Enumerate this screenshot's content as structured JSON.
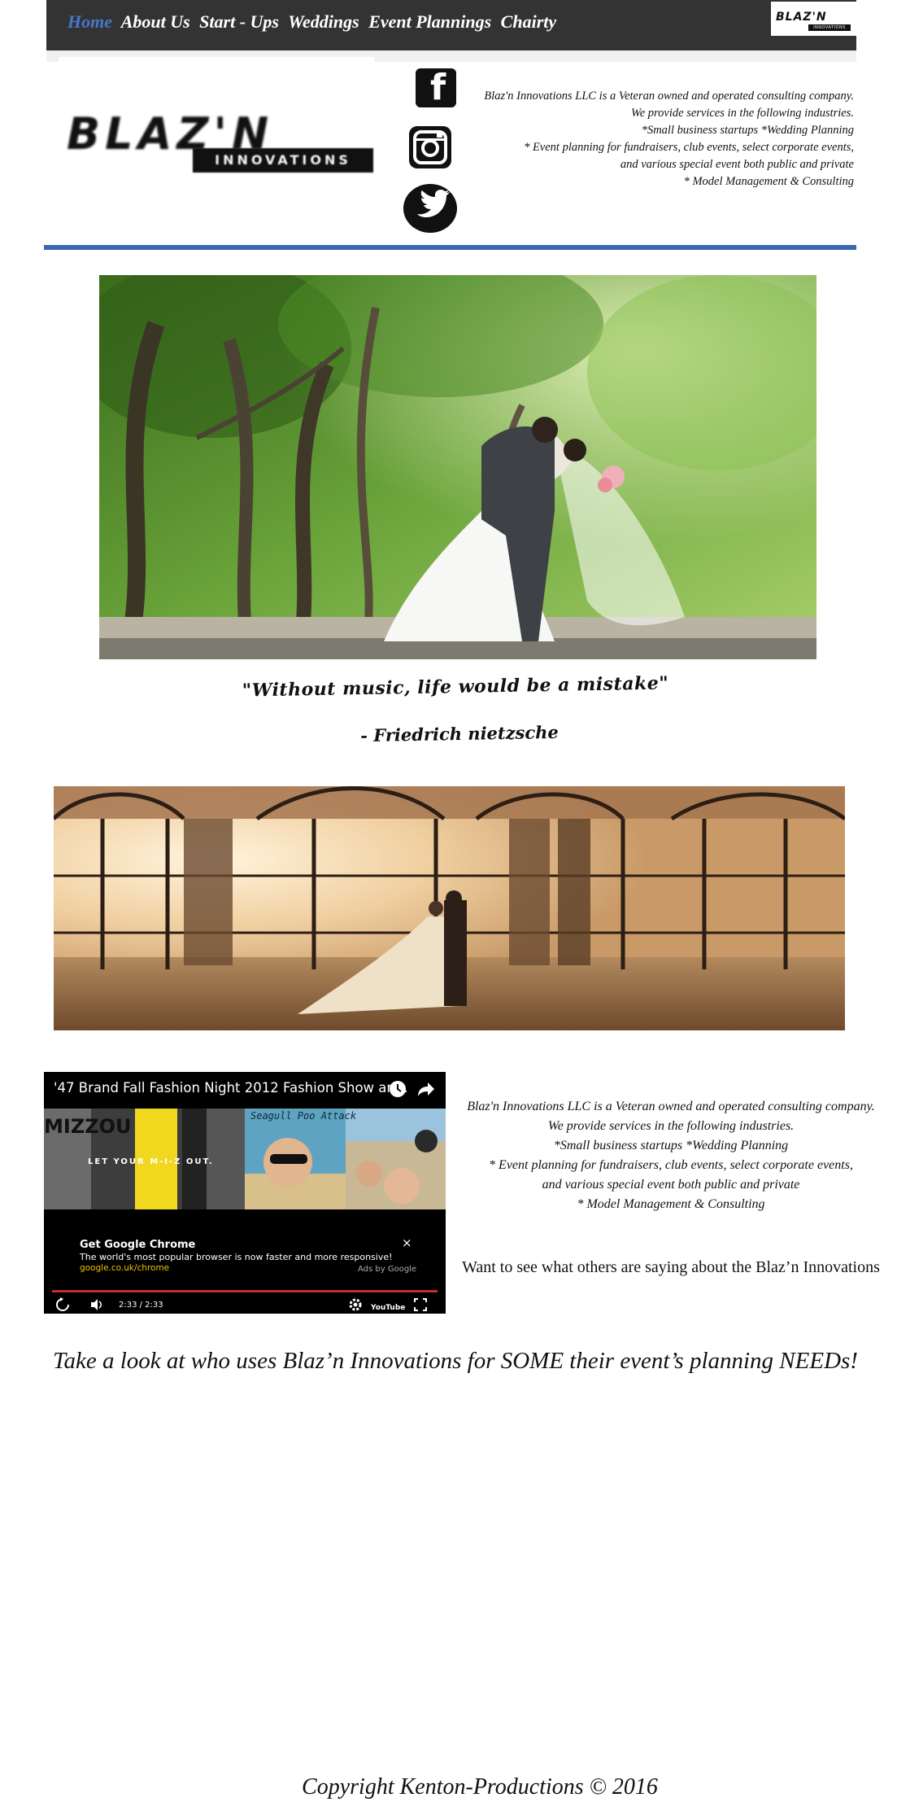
{
  "nav": {
    "items": [
      "Home",
      "About Us",
      "Start - Ups",
      "Weddings",
      "Event Plannings",
      "Chairty"
    ],
    "active_index": 0,
    "logo_word": "BLAZ'N",
    "logo_sub": "INNOVATIONS"
  },
  "header": {
    "logo_word": "BLAZ'N",
    "logo_sub": "INNOVATIONS",
    "social_icons": [
      "facebook-icon",
      "instagram-icon",
      "twitter-icon"
    ],
    "info_lines": [
      "Blaz'n Innovations LLC is a Veteran owned and operated consulting company.",
      "We provide services in the following industries.",
      "*Small business startups  *Wedding Planning",
      "* Event planning for fundraisers, club events, select corporate events,",
      "and various special event  both public and private",
      "* Model Management & Consulting"
    ]
  },
  "colors": {
    "nav_bg": "#333333",
    "accent_blue": "#3b66b1",
    "active_link": "#4a76c9"
  },
  "quote": {
    "text": "\"Without music, life would be a mistake\"",
    "author": "- Friedrich nietzsche"
  },
  "video": {
    "title": "'47 Brand Fall Fashion Night 2012 Fashion Show an...",
    "thumb_left_text": "LET YOUR M-I-Z OUT.",
    "thumb_left_brand": "MIZZOU",
    "thumb_mid_text": "Seagull Poo Attack",
    "ad_title": "Get Google Chrome",
    "ad_desc": "The world's most popular browser is now faster and more responsive!",
    "ad_url": "google.co.uk/chrome",
    "ad_by": "Ads by Google",
    "ad_close": "×",
    "time": "2:33 / 2:33",
    "progress": 1.0,
    "youtube_label": "YouTube"
  },
  "side_info": {
    "lines": [
      "Blaz'n Innovations LLC is a Veteran owned and operated consulting company.",
      "We provide services in the following industries.",
      "*Small business startups  *Wedding Planning",
      "* Event planning for fundraisers, club events, select corporate events,",
      "and various special event  both public and private",
      "* Model Management & Consulting"
    ],
    "testimonial": "Want to see what others are saying about the Blaz’n Innovations"
  },
  "clients_heading": "Take a look at who uses Blaz’n Innovations for  SOME their event’s planning NEEDs!",
  "copyright": "Copyright Kenton-Productions © 2016"
}
